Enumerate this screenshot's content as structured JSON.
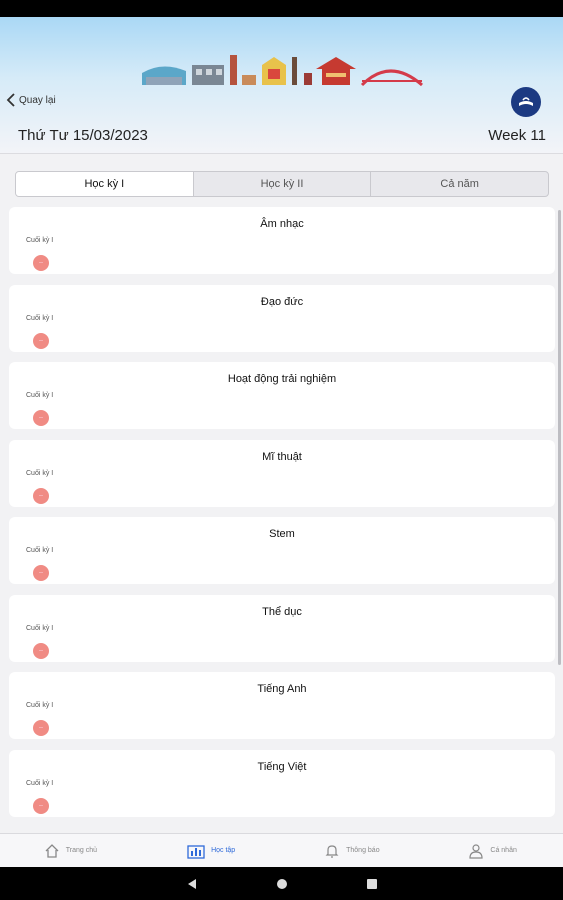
{
  "header": {
    "back_label": "Quay lại",
    "date": "Thứ Tư 15/03/2023",
    "week": "Week 11"
  },
  "tabs": [
    {
      "label": "Học kỳ I",
      "active": true
    },
    {
      "label": "Học kỳ II",
      "active": false
    },
    {
      "label": "Cả năm",
      "active": false
    }
  ],
  "subjects": [
    {
      "title": "Âm nhạc",
      "term": "Cuối kỳ I",
      "badge": "--"
    },
    {
      "title": "Đạo đức",
      "term": "Cuối kỳ I",
      "badge": "--"
    },
    {
      "title": "Hoạt động trải nghiệm",
      "term": "Cuối kỳ I",
      "badge": "--"
    },
    {
      "title": "Mĩ thuật",
      "term": "Cuối kỳ I",
      "badge": "--"
    },
    {
      "title": "Stem",
      "term": "Cuối kỳ I",
      "badge": "--"
    },
    {
      "title": "Thể dục",
      "term": "Cuối kỳ I",
      "badge": "--"
    },
    {
      "title": "Tiếng Anh",
      "term": "Cuối kỳ I",
      "badge": "--"
    },
    {
      "title": "Tiếng Việt",
      "term": "Cuối kỳ I",
      "badge": "--"
    }
  ],
  "bottom_nav": [
    {
      "label": "Trang chủ",
      "icon": "home-icon",
      "active": false
    },
    {
      "label": "Học tập",
      "icon": "chart-book-icon",
      "active": true
    },
    {
      "label": "Thông báo",
      "icon": "bell-icon",
      "active": false
    },
    {
      "label": "Cá nhân",
      "icon": "person-icon",
      "active": false
    }
  ],
  "colors": {
    "accent": "#2f6ad9",
    "badge": "#f08b84",
    "logo": "#1c3a82"
  }
}
